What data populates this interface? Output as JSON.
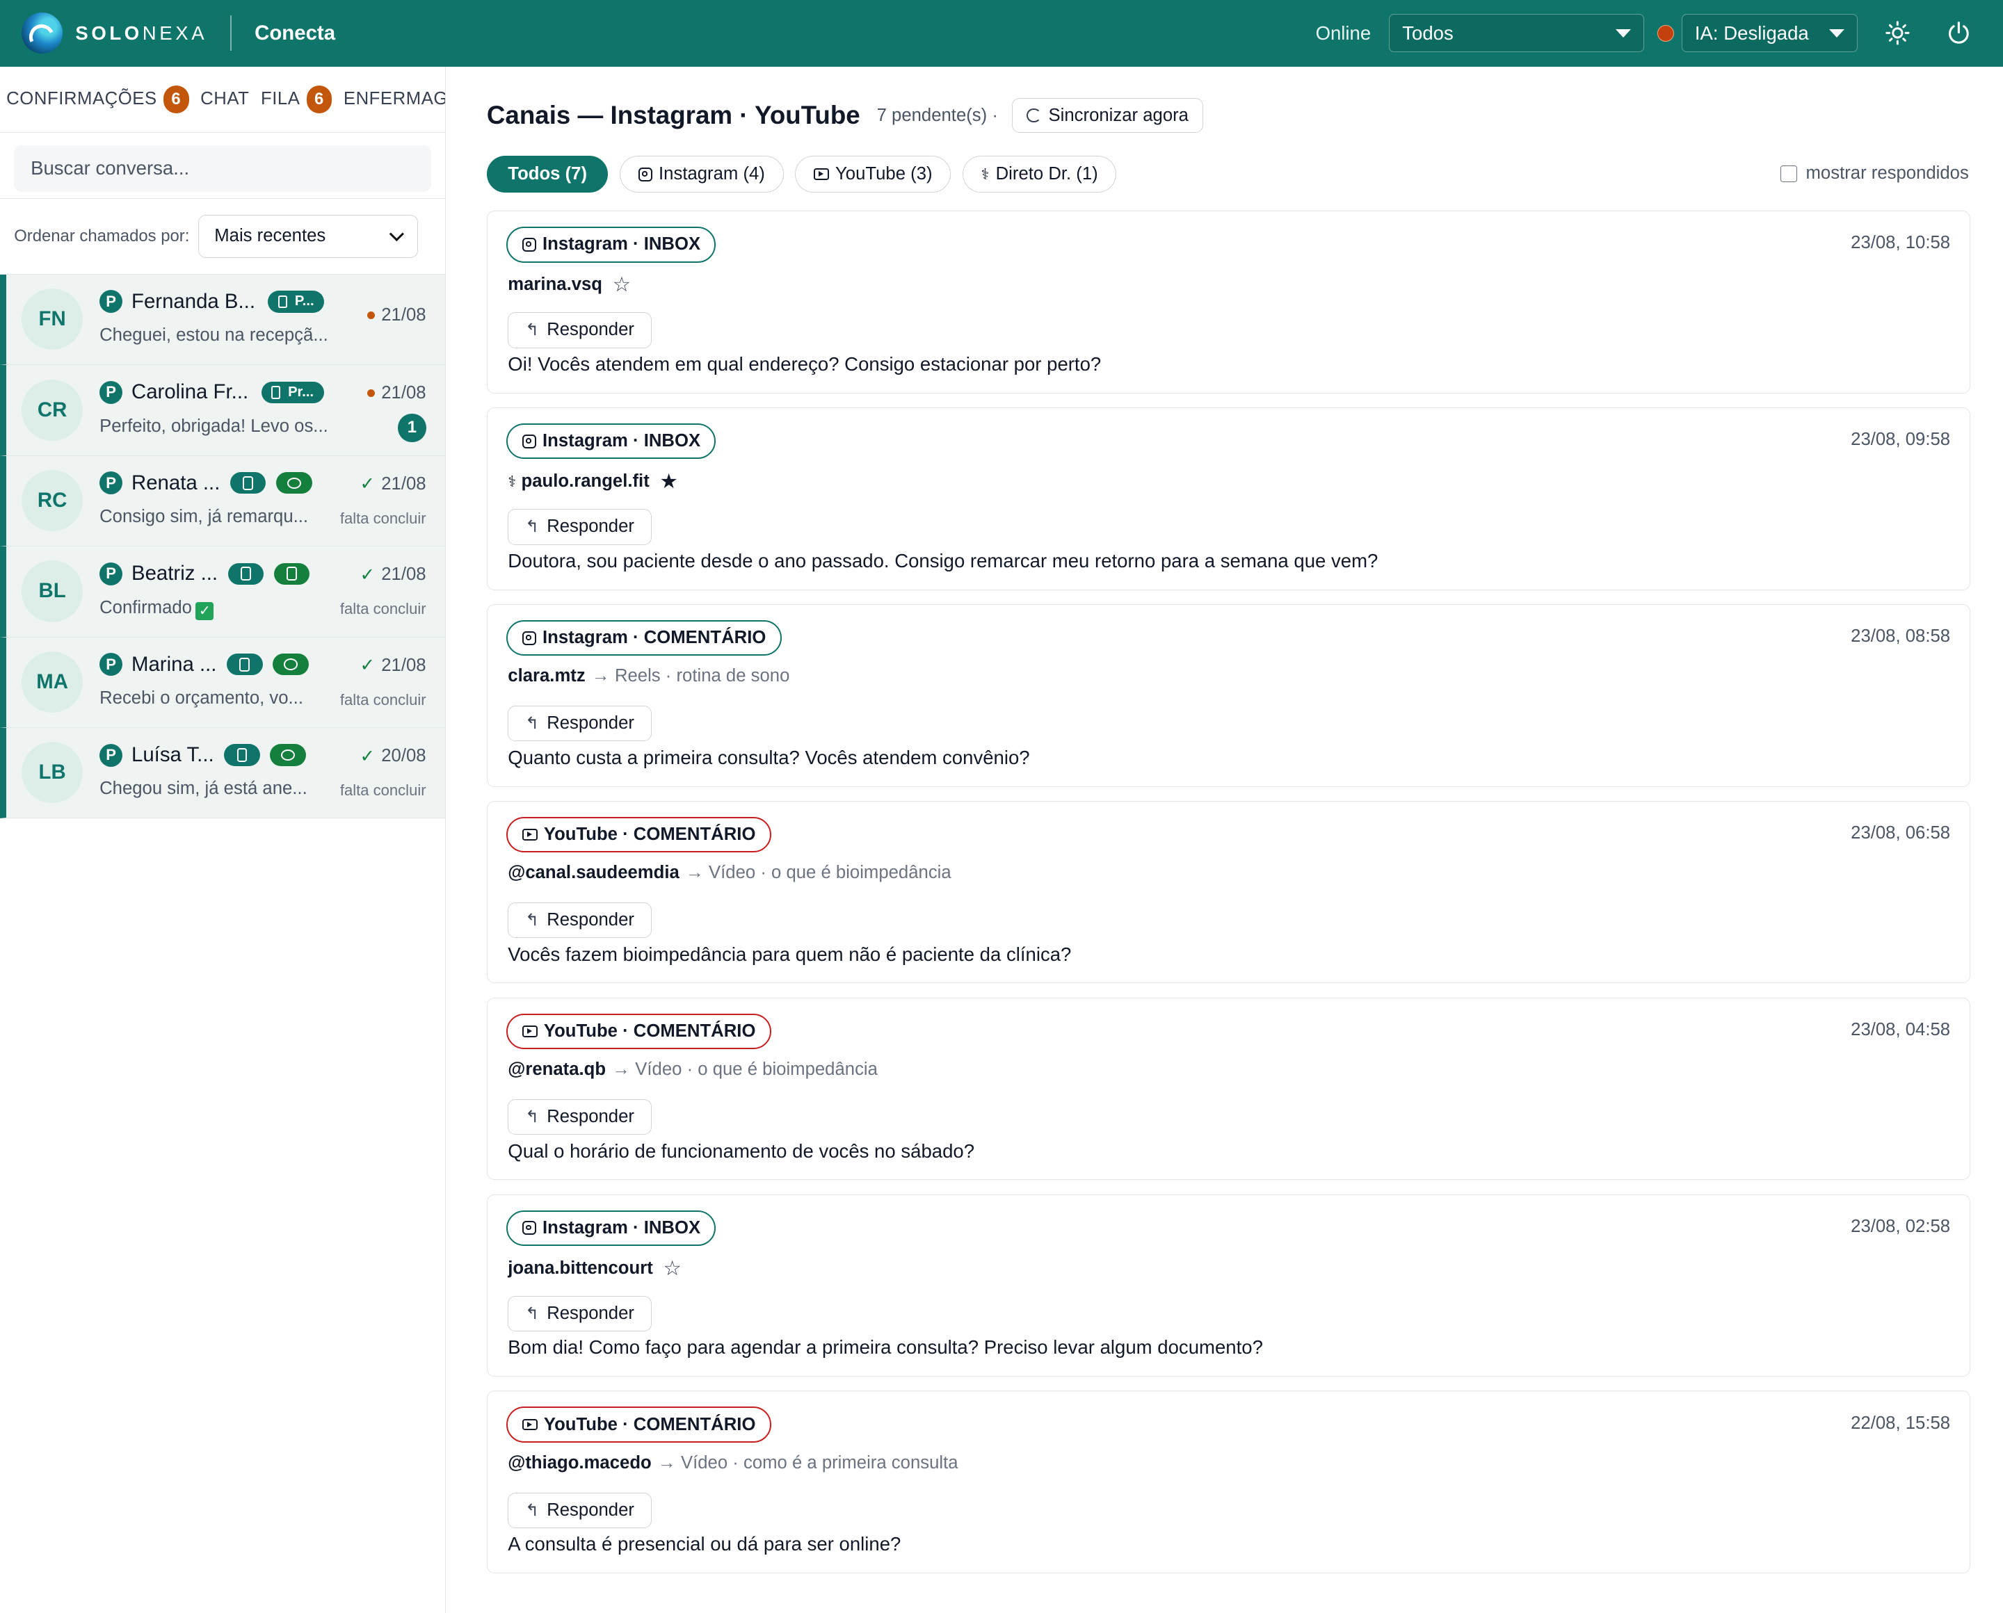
{
  "topbar": {
    "brand_bold": "SOLO",
    "brand_thin": "NEXA",
    "app_name": "Conecta",
    "status_label": "Online",
    "filter_select": "Todos",
    "ai_select": "IA: Desligada",
    "settings_icon": "sun-gear-icon",
    "power_icon": "power-icon"
  },
  "sidebar": {
    "tabs": [
      {
        "label": "CONFIRMAÇÕES",
        "badge": "6"
      },
      {
        "label": "CHAT",
        "badge": ""
      },
      {
        "label": "FILA",
        "badge": "6"
      },
      {
        "label": "ENFERMAGE",
        "badge": ""
      }
    ],
    "search_placeholder": "Buscar conversa...",
    "sort_label": "Ordenar chamados por:",
    "sort_value": "Mais recentes",
    "conversations": [
      {
        "initials": "FN",
        "name": "Fernanda B...",
        "tag": "P...",
        "preview": "Cheguei, estou na recepçã...",
        "date": "21/08",
        "status": "unread",
        "note": "",
        "count": ""
      },
      {
        "initials": "CR",
        "name": "Carolina Fr...",
        "tag": "Pr...",
        "preview": "Perfeito, obrigada! Levo os...",
        "date": "21/08",
        "status": "unread",
        "note": "",
        "count": "1"
      },
      {
        "initials": "RC",
        "name": "Renata ...",
        "tag": "",
        "preview": "Consigo sim, já remarqu...",
        "date": "21/08",
        "status": "done",
        "note": "falta concluir",
        "count": ""
      },
      {
        "initials": "BL",
        "name": "Beatriz ...",
        "tag": "",
        "preview": "Confirmado",
        "date": "21/08",
        "status": "done",
        "note": "falta concluir",
        "count": ""
      },
      {
        "initials": "MA",
        "name": "Marina ...",
        "tag": "",
        "preview": "Recebi o orçamento, vo...",
        "date": "21/08",
        "status": "done",
        "note": "falta concluir",
        "count": ""
      },
      {
        "initials": "LB",
        "name": "Luísa T...",
        "tag": "",
        "preview": "Chegou sim, já está ane...",
        "date": "20/08",
        "status": "done",
        "note": "falta concluir",
        "count": ""
      }
    ]
  },
  "main": {
    "title": "Canais — Instagram · YouTube",
    "pending": "7 pendente(s) ·",
    "sync_label": "Sincronizar agora",
    "filters": [
      {
        "label": "Todos (7)",
        "icon": ""
      },
      {
        "label": "Instagram (4)",
        "icon": "instagram-icon"
      },
      {
        "label": "YouTube (3)",
        "icon": "youtube-icon"
      },
      {
        "label": "Direto Dr. (1)",
        "icon": "stethoscope-icon"
      }
    ],
    "show_answered_label": "mostrar respondidos",
    "reply_label": "Responder",
    "cards": [
      {
        "channel": "Instagram · INBOX",
        "type": "instagram",
        "time": "23/08, 10:58",
        "handle": "marina.vsq",
        "context": "",
        "star": "outline",
        "text": "Oi! Vocês atendem em qual endereço? Consigo estacionar por perto?"
      },
      {
        "channel": "Instagram · INBOX",
        "type": "instagram",
        "time": "23/08, 09:58",
        "handle": "paulo.rangel.fit",
        "context": "",
        "star": "filled",
        "text": "Doutora, sou paciente desde o ano passado. Consigo remarcar meu retorno para a semana que vem?"
      },
      {
        "channel": "Instagram · COMENTÁRIO",
        "type": "instagram",
        "time": "23/08, 08:58",
        "handle": "clara.mtz",
        "context": "Reels · rotina de sono",
        "star": "",
        "text": "Quanto custa a primeira consulta? Vocês atendem convênio?"
      },
      {
        "channel": "YouTube · COMENTÁRIO",
        "type": "youtube",
        "time": "23/08, 06:58",
        "handle": "@canal.saudeemdia",
        "context": "Vídeo · o que é bioimpedância",
        "star": "",
        "text": "Vocês fazem bioimpedância para quem não é paciente da clínica?"
      },
      {
        "channel": "YouTube · COMENTÁRIO",
        "type": "youtube",
        "time": "23/08, 04:58",
        "handle": "@renata.qb",
        "context": "Vídeo · o que é bioimpedância",
        "star": "",
        "text": "Qual o horário de funcionamento de vocês no sábado?"
      },
      {
        "channel": "Instagram · INBOX",
        "type": "instagram",
        "time": "23/08, 02:58",
        "handle": "joana.bittencourt",
        "context": "",
        "star": "outline",
        "text": "Bom dia! Como faço para agendar a primeira consulta? Preciso levar algum documento?"
      },
      {
        "channel": "YouTube · COMENTÁRIO",
        "type": "youtube",
        "time": "22/08, 15:58",
        "handle": "@thiago.macedo",
        "context": "Vídeo · como é a primeira consulta",
        "star": "",
        "text": "A consulta é presencial ou dá para ser online?"
      }
    ]
  },
  "colors": {
    "primary": "#0f756b",
    "badge_orange": "#c2570c",
    "youtube_red": "#c81e1e",
    "done_green": "#15803d"
  }
}
